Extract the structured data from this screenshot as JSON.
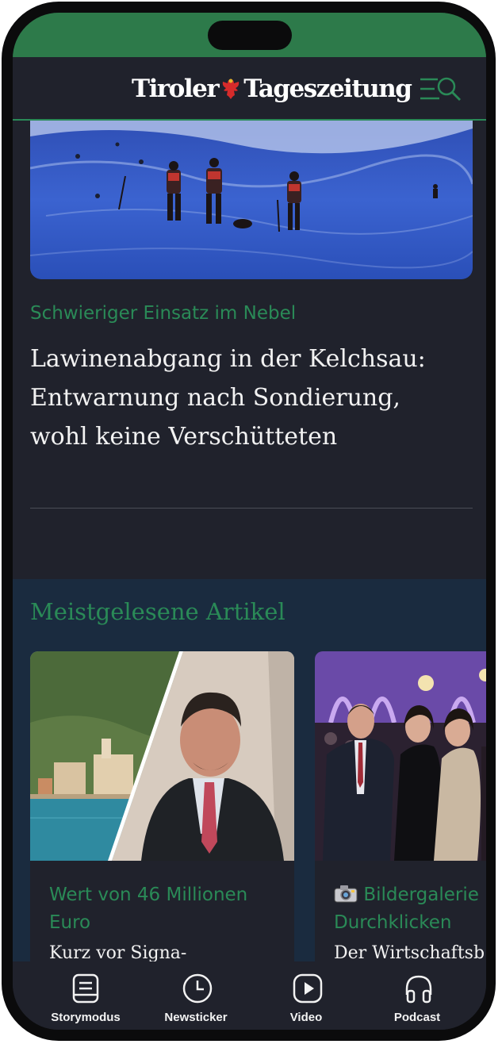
{
  "header": {
    "logo_left": "Tiroler",
    "logo_right": "Tageszeitung",
    "menu_icon": "menu-search-icon"
  },
  "hero": {
    "image_icon": "avalanche-rescue-photo",
    "kicker": "Schwieriger Einsatz im Nebel",
    "headline": "Lawinenabgang in der Kelchsau: Entwarnung nach Sondierung, wohl keine Verschütteten"
  },
  "most_read": {
    "title": "Meistgelesene Artikel",
    "cards": [
      {
        "image_icon": "lake-town-and-man-photo",
        "kicker": "Wert von 46 Millionen Euro",
        "title": "Kurz vor Signa-"
      },
      {
        "image_icon": "gala-people-photo",
        "kicker_icon": "camera-icon",
        "kicker": "Bildergalerie Durchklicken",
        "title": "Der Wirtschaftsb"
      }
    ]
  },
  "bottom_nav": {
    "items": [
      {
        "label": "Storymodus",
        "icon": "storymode-icon"
      },
      {
        "label": "Newsticker",
        "icon": "clock-icon"
      },
      {
        "label": "Video",
        "icon": "play-icon"
      },
      {
        "label": "Podcast",
        "icon": "headphones-icon"
      }
    ]
  },
  "colors": {
    "accent_green": "#2a8a57",
    "status_green": "#2d7a4a",
    "background": "#20222c",
    "most_read_bg": "#1a2b3f",
    "text": "#f2f2f2"
  }
}
